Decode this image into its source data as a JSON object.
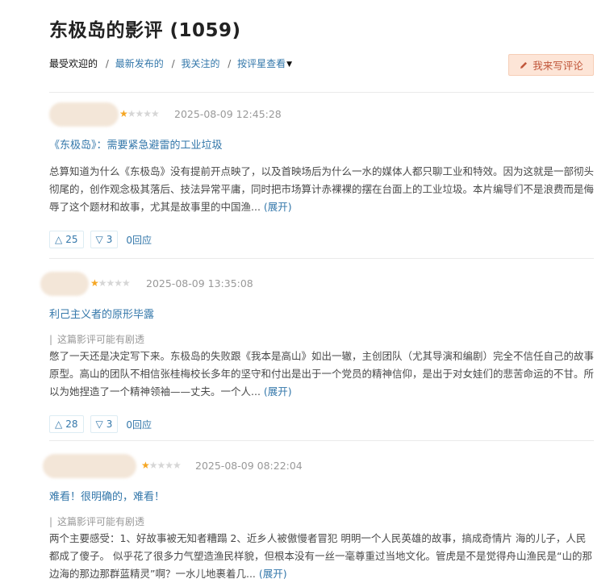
{
  "page": {
    "title": "东极岛的影评 (1059)"
  },
  "nav": {
    "current": "最受欢迎的",
    "sep": "/",
    "links": [
      "最新发布的",
      "我关注的",
      "按评星查看"
    ]
  },
  "write_button": {
    "label": "我来写评论"
  },
  "reviews": [
    {
      "stars": 1,
      "time": "2025-08-09 12:45:28",
      "title": "《东极岛》：需要紧急避雷的工业垃圾",
      "spoiler": "",
      "body": "总算知道为什么《东极岛》没有提前开点映了，以及首映场后为什么一水的媒体人都只聊工业和特效。因为这就是一部彻头彻尾的，创作观念极其落后、技法异常平庸，同时把市场算计赤裸裸的摆在台面上的工业垃圾。本片编导们不是浪费而是侮辱了这个题材和故事，尤其是故事里的中国渔...",
      "more": "(展开)",
      "up": "25",
      "down": "3",
      "replies": "0回应"
    },
    {
      "stars": 1,
      "time": "2025-08-09 13:35:08",
      "title": "利己主义者的原形毕露",
      "spoiler": "这篇影评可能有剧透",
      "body": "憋了一天还是决定写下来。东极岛的失败跟《我本是高山》如出一辙，主创团队（尤其导演和编剧）完全不信任自己的故事原型。高山的团队不相信张桂梅校长多年的坚守和付出是出于一个党员的精神信仰，是出于对女娃们的悲苦命运的不甘。所以为她捏造了一个精神领袖——丈夫。一个人...",
      "more": "(展开)",
      "up": "28",
      "down": "3",
      "replies": "0回应"
    },
    {
      "stars": 1,
      "time": "2025-08-09 08:22:04",
      "title": "难看！很明确的，难看！",
      "spoiler": "这篇影评可能有剧透",
      "body": "两个主要感受：1、好故事被无知者糟蹋 2、近乡人被傲慢者冒犯 明明一个人民英雄的故事，搞成奇情片 海的儿子，人民都成了傻子。 似乎花了很多力气塑造渔民样貌，但根本没有一丝一毫尊重过当地文化。管虎是不是觉得舟山渔民是“山的那边海的那边那群蓝精灵”啊？一水儿地裹着几...",
      "more": "(展开)",
      "up": "",
      "down": "",
      "replies": ""
    }
  ]
}
